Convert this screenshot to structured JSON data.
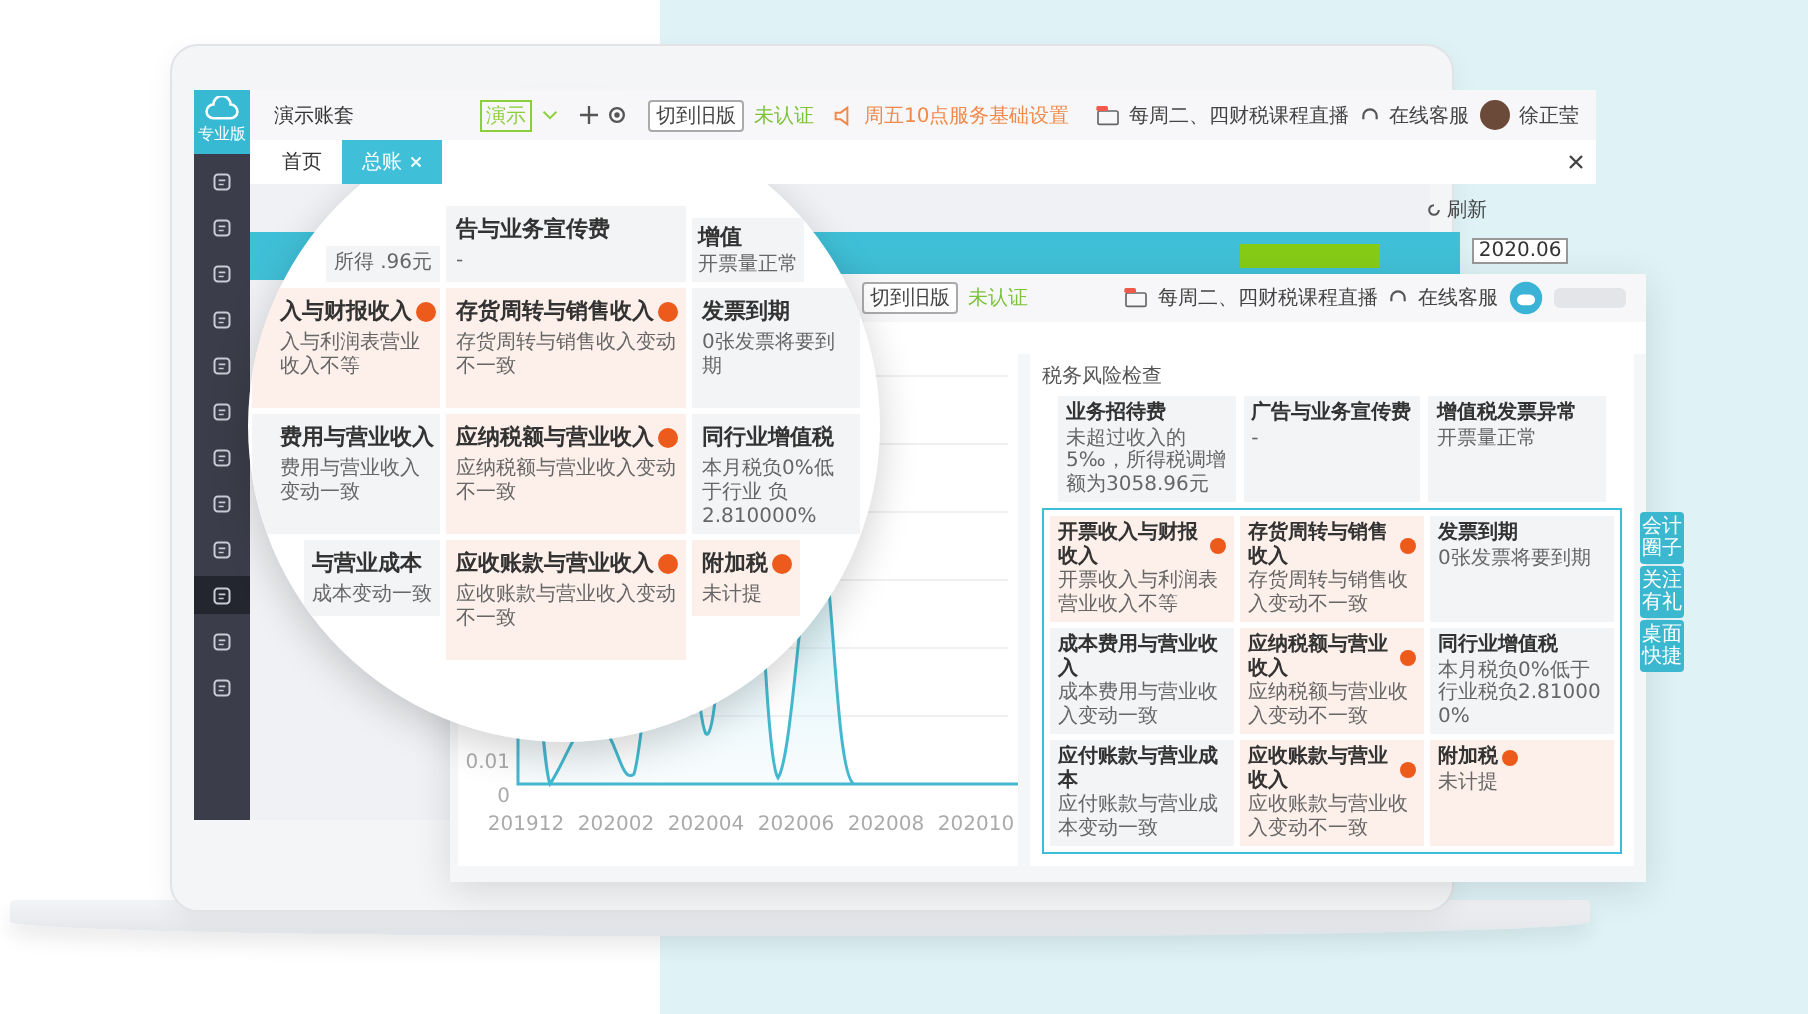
{
  "app_header": {
    "logo_label": "专业版",
    "account": "演示账套",
    "account_tag": "演示",
    "switch_button": "切到旧版",
    "auth_status": "未认证",
    "notice": "周五10点服务基础设置",
    "live": "每周二、四财税课程直播",
    "support": "在线客服",
    "user_name": "徐正莹"
  },
  "sidebar": {
    "items": [
      {
        "selected": false
      },
      {
        "selected": false
      },
      {
        "selected": false
      },
      {
        "selected": false
      },
      {
        "selected": false
      },
      {
        "selected": false
      },
      {
        "selected": false
      },
      {
        "selected": false
      },
      {
        "selected": false
      },
      {
        "selected": true
      },
      {
        "selected": false
      },
      {
        "selected": false
      }
    ]
  },
  "tabs": [
    {
      "label": "首页",
      "selected": false,
      "closable": false
    },
    {
      "label": "总账",
      "selected": true,
      "closable": true
    }
  ],
  "refresh": "刷新",
  "banner": {
    "date": "2020.06"
  },
  "magnifier": {
    "rows": [
      [
        {
          "desc": "所得 .96元",
          "alert": false
        },
        {
          "title": "告与业务宣传费",
          "desc": "-",
          "alert": false
        },
        {
          "title": "增值",
          "desc": "开票量正常",
          "alert": false
        }
      ],
      [
        {
          "title": "入与财报收入",
          "desc": "入与利润表营业收入不等",
          "alert": true
        },
        {
          "title": "存货周转与销售收入",
          "desc": "存货周转与销售收入变动不一致",
          "alert": true
        },
        {
          "title": "发票到期",
          "desc": "0张发票将要到期",
          "alert": false
        }
      ],
      [
        {
          "title": "费用与营业收入",
          "desc": "费用与营业收入变动一致",
          "alert": false
        },
        {
          "title": "应纳税额与营业收入",
          "desc": "应纳税额与营业收入变动不一致",
          "alert": true
        },
        {
          "title": "同行业增值税",
          "desc": "本月税负0%低于行业 负2.810000%",
          "alert": false
        }
      ],
      [
        {
          "title": "与营业成本",
          "desc": "成本变动一致",
          "alert": false
        },
        {
          "title": "应收账款与营业收入",
          "desc": "应收账款与营业收入变动不一致",
          "alert": true
        },
        {
          "title": "附加税",
          "desc": "未计提",
          "alert": true
        }
      ]
    ]
  },
  "front_panel": {
    "switch_button": "切到旧版",
    "auth_status": "未认证",
    "live": "每周二、四财税课程直播",
    "support": "在线客服",
    "section_title": "税务风险检查",
    "summary_cards": [
      {
        "title": "业务招待费",
        "desc": "未超过收入的5‰，所得税调增额为3058.96元"
      },
      {
        "title": "广告与业务宣传费",
        "desc": "-"
      },
      {
        "title": "增值税发票异常",
        "desc": "开票量正常"
      }
    ],
    "risk_cards": [
      {
        "title": "开票收入与财报收入",
        "desc": "开票收入与利润表营业收入不等",
        "alert": true
      },
      {
        "title": "存货周转与销售收入",
        "desc": "存货周转与销售收入变动不一致",
        "alert": true
      },
      {
        "title": "发票到期",
        "desc": "0张发票将要到期",
        "alert": false
      },
      {
        "title": "成本费用与营业收入",
        "desc": "成本费用与营业收入变动一致",
        "alert": false
      },
      {
        "title": "应纳税额与营业收入",
        "desc": "应纳税额与营业收入变动不一致",
        "alert": true
      },
      {
        "title": "同行业增值税",
        "desc": "本月税负0%低于行业税负2.810000%",
        "alert": false
      },
      {
        "title": "应付账款与营业成本",
        "desc": "应付账款与营业成本变动一致",
        "alert": false
      },
      {
        "title": "应收账款与营业收入",
        "desc": "应收账款与营业收入变动不一致",
        "alert": true
      },
      {
        "title": "附加税",
        "desc": "未计提",
        "alert": true
      }
    ],
    "side_tabs": [
      "会计圈子",
      "关注有礼",
      "桌面快捷"
    ]
  },
  "chart": {
    "y_ticks": [
      "0.01",
      "0"
    ],
    "x_labels": [
      "201912",
      "202002",
      "202004",
      "202006",
      "202008",
      "202010"
    ]
  }
}
